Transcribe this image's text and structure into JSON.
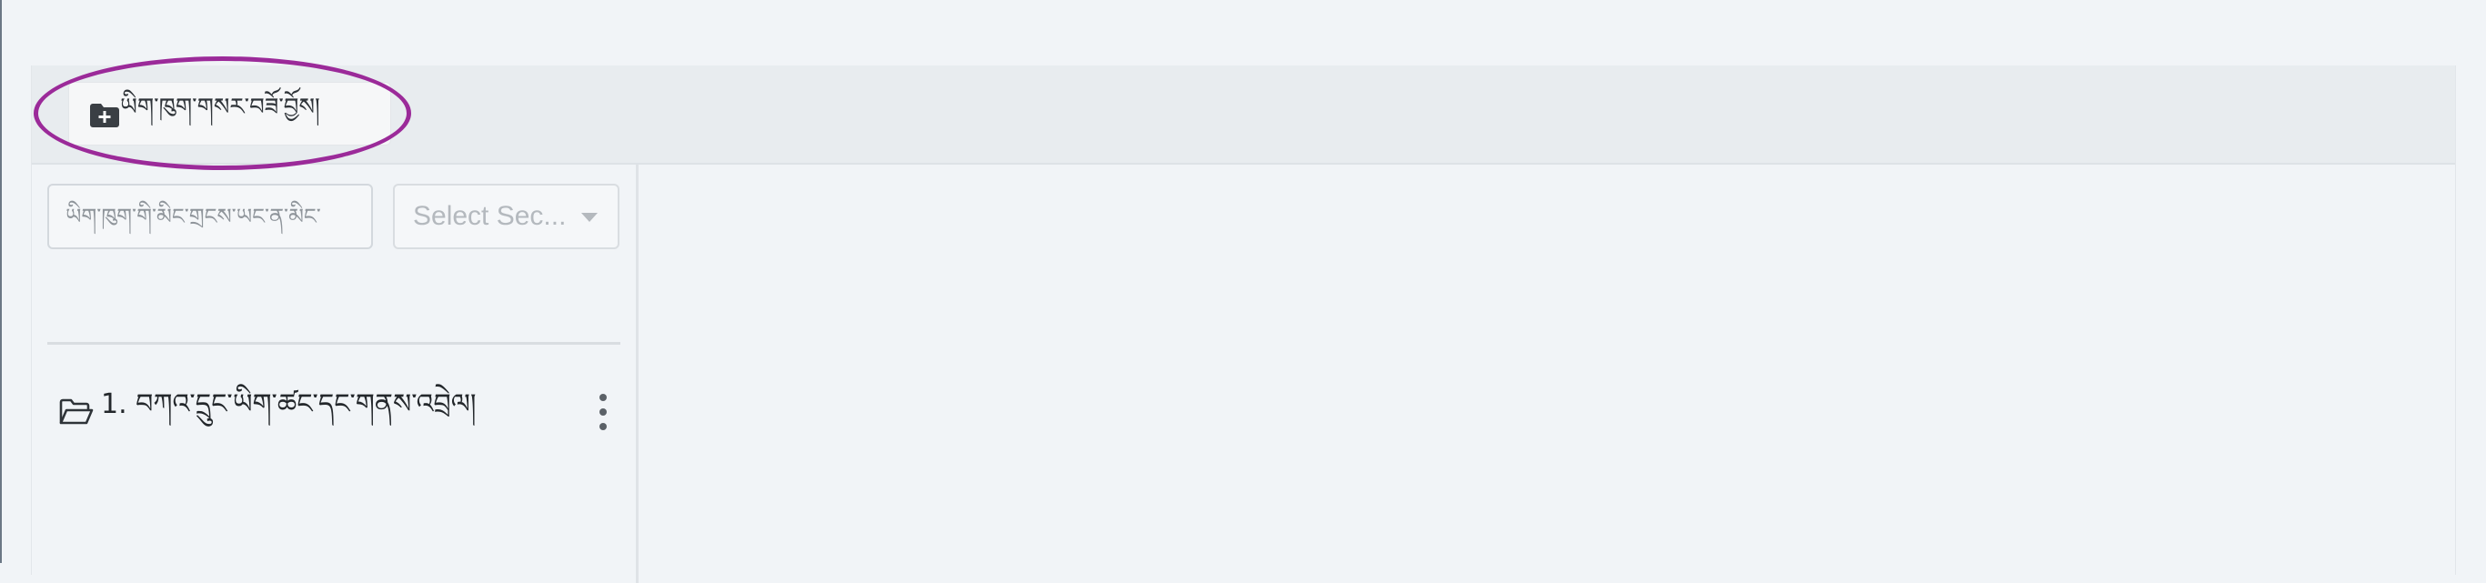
{
  "toolbar": {
    "create_button_label": "ཡིག་ཁུག་གསར་བཟོ་བྱོས།",
    "create_button_icon": "folder-plus-icon"
  },
  "sidebar": {
    "search_placeholder": "ཡིག་ཁུག་གི་མིང་གྲངས་ཡང་ན་མིང་",
    "section_select_placeholder": "Select Sec...",
    "tree_items": [
      {
        "label": "1. བཀའ་དྲུང་ཡིག་ཚང་དང་གནས་འབྲེལ།",
        "icon": "folder-open-icon"
      }
    ]
  },
  "colors": {
    "highlight_ring": "#9b2a99",
    "toolbar_bg": "#e8ecef",
    "page_bg": "#f1f4f7"
  }
}
